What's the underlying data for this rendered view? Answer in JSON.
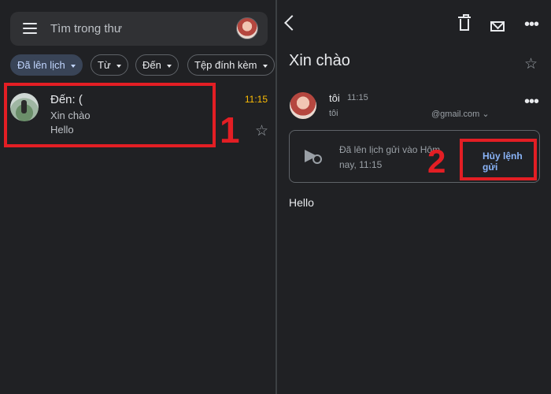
{
  "inbox": {
    "search_placeholder": "Tìm trong thư",
    "chips": [
      {
        "label": "Đã lên lịch"
      },
      {
        "label": "Từ"
      },
      {
        "label": "Đến"
      },
      {
        "label": "Tệp đính kèm"
      }
    ],
    "mail": {
      "from": "Đến: (",
      "subject": "Xin chào",
      "snippet": "Hello",
      "time": "11:15"
    }
  },
  "detail": {
    "subject": "Xin chào",
    "sender_name": "tôi",
    "sender_time": "11:15",
    "recipient": "tôi",
    "recipient_email": "@gmail.com ⌄",
    "schedule_text": "Đã lên lịch gửi vào Hôm nay, 11:15",
    "cancel_label": "Hủy lệnh gửi",
    "body": "Hello"
  },
  "annotations": {
    "marker_1": "1",
    "marker_2": "2"
  },
  "colors": {
    "background": "#202124",
    "accent_link": "#8ab4f8",
    "time_highlight": "#fbbc04",
    "annotation_red": "#e31e24"
  }
}
